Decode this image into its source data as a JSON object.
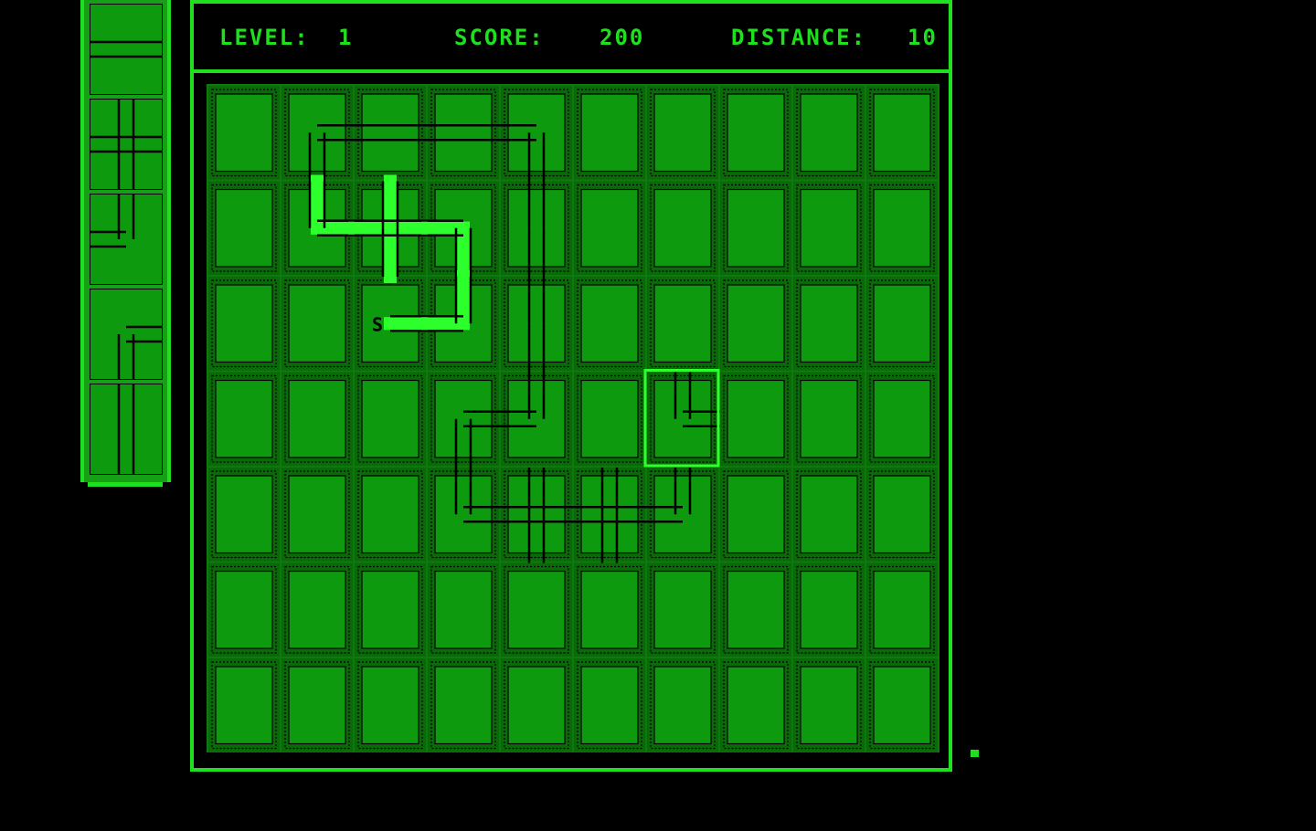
{
  "hud": {
    "level_label": "LEVEL:",
    "level_value": "1",
    "score_label": "SCORE:",
    "score_value": "200",
    "distance_label": "DISTANCE:",
    "distance_value": "10"
  },
  "board": {
    "columns": 10,
    "rows": 7,
    "start_marker": "S",
    "start_cell": [
      2,
      2
    ],
    "cursor_cell": [
      6,
      3
    ],
    "pipes": [
      {
        "col": 1,
        "row": 0,
        "type": "corner-se"
      },
      {
        "col": 2,
        "row": 0,
        "type": "horizontal"
      },
      {
        "col": 3,
        "row": 0,
        "type": "horizontal"
      },
      {
        "col": 4,
        "row": 0,
        "type": "corner-sw"
      },
      {
        "col": 1,
        "row": 1,
        "type": "corner-ne",
        "filled": true
      },
      {
        "col": 2,
        "row": 1,
        "type": "cross",
        "filled": true
      },
      {
        "col": 3,
        "row": 1,
        "type": "corner-sw",
        "filled": true
      },
      {
        "col": 4,
        "row": 1,
        "type": "vertical"
      },
      {
        "col": 2,
        "row": 2,
        "type": "start-east",
        "filled": true
      },
      {
        "col": 3,
        "row": 2,
        "type": "corner-nw",
        "filled": true
      },
      {
        "col": 4,
        "row": 2,
        "type": "vertical"
      },
      {
        "col": 3,
        "row": 3,
        "type": "corner-se"
      },
      {
        "col": 4,
        "row": 3,
        "type": "corner-nw"
      },
      {
        "col": 6,
        "row": 3,
        "type": "corner-ne",
        "cursor": true
      },
      {
        "col": 3,
        "row": 4,
        "type": "corner-ne"
      },
      {
        "col": 4,
        "row": 4,
        "type": "cross"
      },
      {
        "col": 5,
        "row": 4,
        "type": "cross"
      },
      {
        "col": 6,
        "row": 4,
        "type": "corner-nw"
      }
    ]
  },
  "queue": {
    "pieces": [
      "horizontal",
      "cross",
      "corner-nw",
      "corner-se",
      "vertical"
    ]
  },
  "colors": {
    "bright": "#1fe01f",
    "tile": "#0e9a0e",
    "tile_dark": "#0a6a0a",
    "pipe": "#000000",
    "flow": "#2cff2c"
  }
}
